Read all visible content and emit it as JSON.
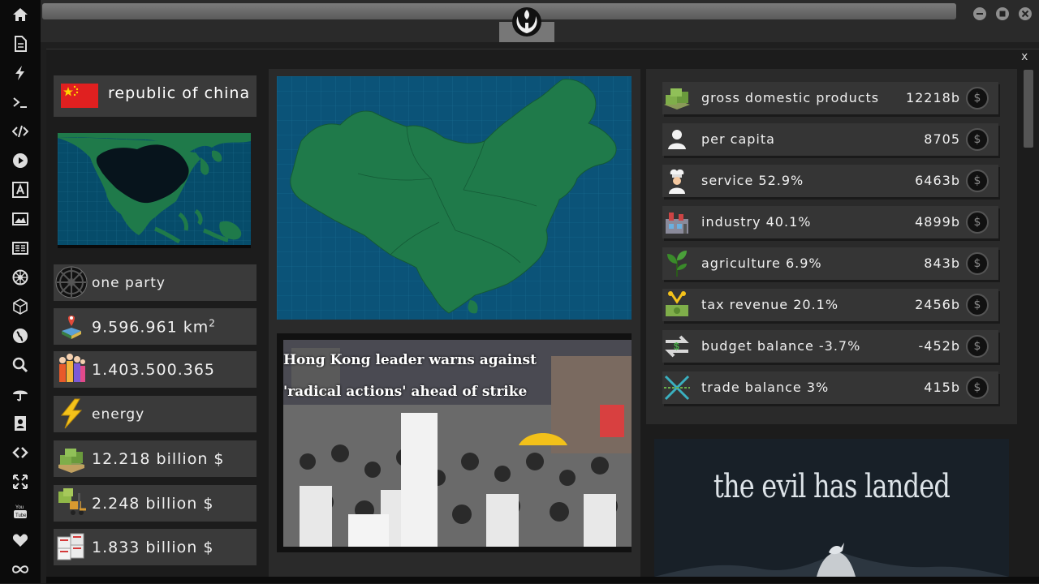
{
  "sidebar": {
    "icons": [
      "home-icon",
      "document-icon",
      "bolt-icon",
      "terminal-icon",
      "code-icon",
      "play-icon",
      "translate-icon",
      "image-icon",
      "newspaper-icon",
      "empire-icon",
      "cube-icon",
      "globe-icon",
      "search-icon",
      "umbrella-icon",
      "contacts-icon",
      "link-icon",
      "expand-icon",
      "youtube-icon",
      "heart-icon",
      "infinity-icon"
    ]
  },
  "window": {
    "close_label": "x"
  },
  "country": {
    "name": "republic of china",
    "flag_color": "#e02020",
    "government": "one party",
    "area": "9.596.961 km",
    "area_unit_sup": "2",
    "population": "1.403.500.365",
    "energy": "energy",
    "gdp": "12.218 billion $",
    "exports": "2.248 billion $",
    "imports": "1.833 billion $"
  },
  "news": {
    "headline": "Hong Kong leader warns against 'radical actions' ahead of strike"
  },
  "economy": [
    {
      "icon": "money-stack-icon",
      "label": "gross domestic products",
      "value": "12218b"
    },
    {
      "icon": "person-icon",
      "label": "per capita",
      "value": "8705"
    },
    {
      "icon": "chef-icon",
      "label": "service 52.9%",
      "value": "6463b"
    },
    {
      "icon": "factory-icon",
      "label": "industry 40.1%",
      "value": "4899b"
    },
    {
      "icon": "sprout-icon",
      "label": "agriculture 6.9%",
      "value": "843b"
    },
    {
      "icon": "tax-icon",
      "label": "tax revenue 20.1%",
      "value": "2456b"
    },
    {
      "icon": "budget-arrows-icon",
      "label": "budget balance -3.7%",
      "value": "-452b"
    },
    {
      "icon": "trade-icon",
      "label": "trade balance 3%",
      "value": "415b"
    }
  ],
  "ad": {
    "headline": "the evil has landed"
  },
  "colors": {
    "map_ocean": "#0b5378",
    "map_land": "#1f7a4a",
    "highlight_land": "#07141c"
  }
}
